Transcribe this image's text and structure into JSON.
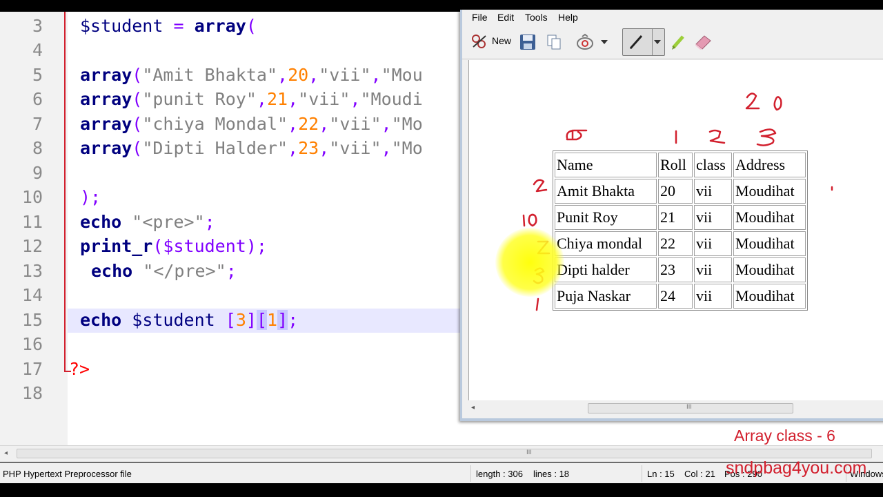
{
  "editor": {
    "line_numbers": [
      "3",
      "4",
      "5",
      "6",
      "7",
      "8",
      "9",
      "10",
      "11",
      "12",
      "13",
      "14",
      "15",
      "16",
      "17",
      "18"
    ],
    "code": {
      "line3": {
        "var": "$student",
        "eq": " = ",
        "kw": "array",
        "paren": "("
      },
      "line5": {
        "kw": "array",
        "args": [
          "\"Amit Bhakta\"",
          ",",
          "20",
          ",",
          "\"vii\"",
          ",",
          "\"Mou"
        ]
      },
      "line6": {
        "kw": "array",
        "args": [
          "\"punit Roy\"",
          ",",
          "21",
          ",",
          "\"vii\"",
          ",",
          "\"Moudi"
        ]
      },
      "line7": {
        "kw": "array",
        "args": [
          "\"chiya Mondal\"",
          ",",
          "22",
          ",",
          "\"vii\"",
          ",",
          "\"Mo"
        ]
      },
      "line8": {
        "kw": "array",
        "args": [
          "\"Dipti Halder\"",
          ",",
          "23",
          ",",
          "\"vii\"",
          ",",
          "\"Mo"
        ]
      },
      "line10": ");",
      "line11": {
        "kw": "echo",
        "str": "\"<pre>\"",
        "end": ";"
      },
      "line12": {
        "kw": "print_r",
        "rest": "($student);"
      },
      "line13": {
        "kw": "echo",
        "str": "\"</pre>\"",
        "end": ";"
      },
      "line15": {
        "kw": "echo",
        "var": "$student",
        "idx1": "3",
        "idx2": "1",
        "end": ";"
      },
      "line17": "?>"
    }
  },
  "statusbar": {
    "file_type": "PHP Hypertext Preprocessor file",
    "length": "length : 306",
    "lines": "lines : 18",
    "ln": "Ln : 15",
    "col": "Col : 21",
    "pos": "Pos : 290",
    "eol": "Windows"
  },
  "paint": {
    "menu": [
      "File",
      "Edit",
      "Tools",
      "Help"
    ],
    "toolbar": {
      "new_label": "New"
    },
    "table": {
      "headers": [
        "Name",
        "Roll",
        "class",
        "Address"
      ],
      "rows": [
        [
          "Amit Bhakta",
          "20",
          "vii",
          "Moudihat"
        ],
        [
          "Punit Roy",
          "21",
          "vii",
          "Moudihat"
        ],
        [
          "Chiya mondal",
          "22",
          "vii",
          "Moudihat"
        ],
        [
          "Dipti halder",
          "23",
          "vii",
          "Moudihat"
        ],
        [
          "Puja Naskar",
          "24",
          "vii",
          "Moudihat"
        ]
      ]
    },
    "scroll_grip": "III"
  },
  "watermark": {
    "title": "Array class - 6",
    "site": "sndpbag4you.com"
  },
  "colors": {
    "keyword": "#00007f",
    "string": "#808080",
    "number": "#ff8000",
    "operator": "#8000ff",
    "annotation": "#d2202e"
  }
}
